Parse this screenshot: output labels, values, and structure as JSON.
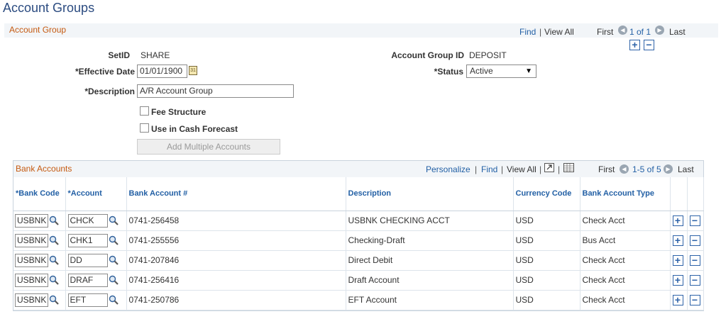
{
  "page": {
    "title": "Account Groups"
  },
  "account_group": {
    "section_title": "Account Group",
    "nav": {
      "find": "Find",
      "sep": "|",
      "view_all": "View All",
      "first": "First",
      "range": "1 of 1",
      "last": "Last"
    },
    "setid_label": "SetID",
    "setid_value": "SHARE",
    "group_id_label": "Account Group ID",
    "group_id_value": "DEPOSIT",
    "effective_date_label": "*Effective Date",
    "effective_date_value": "01/01/1900",
    "status_label": "*Status",
    "status_value": "Active",
    "description_label": "*Description",
    "description_value": "A/R Account Group",
    "fee_structure_label": "Fee Structure",
    "fee_structure_checked": false,
    "cash_forecast_label": "Use in Cash Forecast",
    "cash_forecast_checked": false,
    "add_multiple_label": "Add Multiple Accounts"
  },
  "bank_accounts": {
    "section_title": "Bank Accounts",
    "tools": {
      "personalize": "Personalize",
      "find": "Find",
      "sep": "|",
      "view_all": "View All",
      "first": "First",
      "range": "1-5 of 5",
      "last": "Last"
    },
    "columns": [
      "*Bank Code",
      "*Account",
      "Bank Account #",
      "Description",
      "Currency Code",
      "Bank Account Type"
    ],
    "rows": [
      {
        "bank_code": "USBNK",
        "account": "CHCK",
        "number": "0741-256458",
        "description": "USBNK CHECKING ACCT",
        "currency": "USD",
        "type": "Check Acct"
      },
      {
        "bank_code": "USBNK",
        "account": "CHK1",
        "number": "0741-255556",
        "description": "Checking-Draft",
        "currency": "USD",
        "type": "Bus Acct"
      },
      {
        "bank_code": "USBNK",
        "account": "DD",
        "number": "0741-207846",
        "description": "Direct Debit",
        "currency": "USD",
        "type": "Check Acct"
      },
      {
        "bank_code": "USBNK",
        "account": "DRAF",
        "number": "0741-256416",
        "description": "Draft Account",
        "currency": "USD",
        "type": "Check Acct"
      },
      {
        "bank_code": "USBNK",
        "account": "EFT",
        "number": "0741-250786",
        "description": "EFT Account",
        "currency": "USD",
        "type": "Check Acct"
      }
    ]
  },
  "buttons": {
    "add": "+",
    "remove": "−"
  }
}
